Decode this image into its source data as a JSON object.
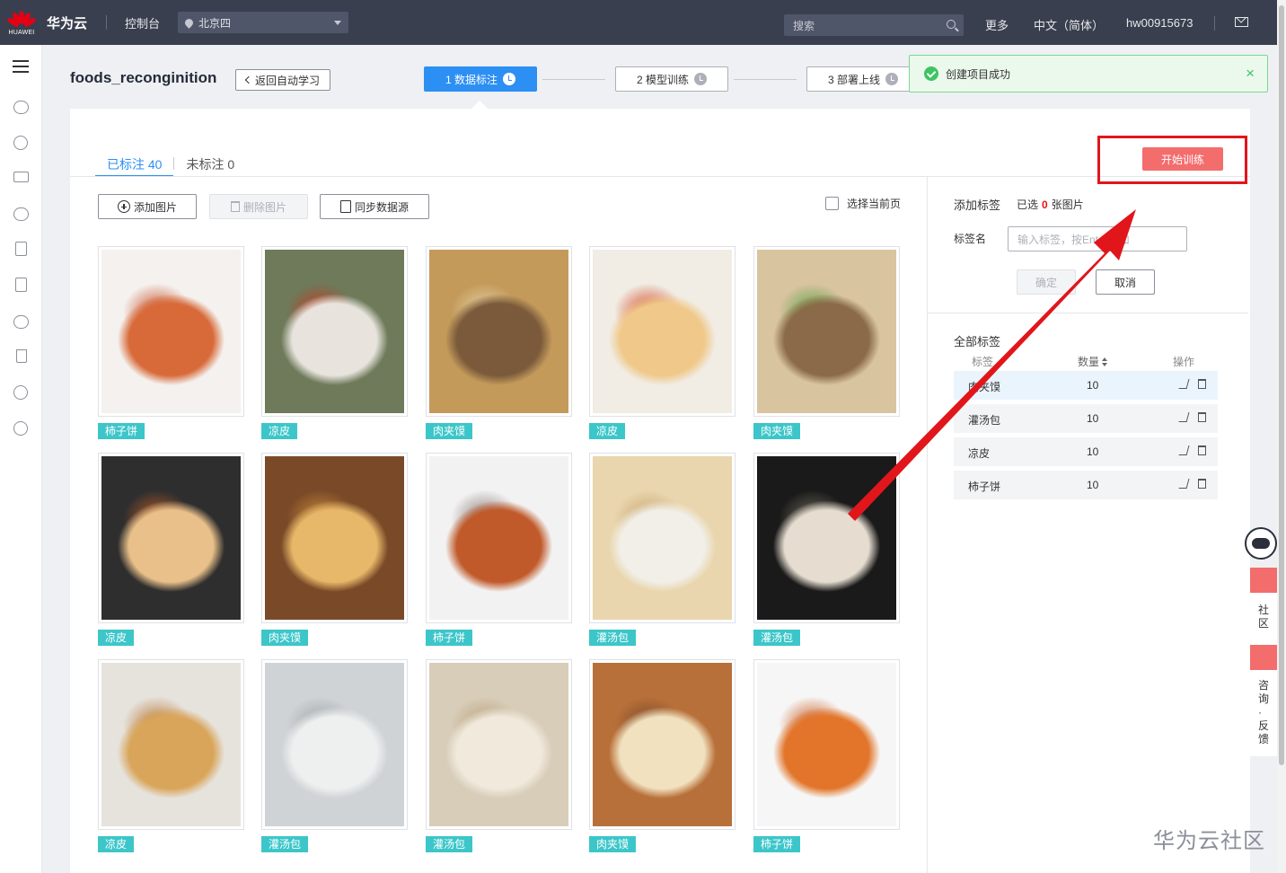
{
  "topbar": {
    "logo_text": "HUAWEI",
    "brand": "华为云",
    "console": "控制台",
    "region": "北京四",
    "search_placeholder": "搜索",
    "more": "更多",
    "language": "中文（简体）",
    "user": "hw00915673"
  },
  "header": {
    "project_name": "foods_recongin",
    "project_name_suffix": "ition",
    "back_label": "返回自动学习",
    "steps": [
      {
        "label": "1 数据标注",
        "state": "active"
      },
      {
        "label": "2 模型训练",
        "state": "pending"
      },
      {
        "label": "3 部署上线",
        "state": "pending"
      }
    ]
  },
  "toast": {
    "message": "创建项目成功",
    "close": "×"
  },
  "tabs": [
    {
      "label": "已标注 40",
      "active": true
    },
    {
      "label": "未标注 0",
      "active": false
    }
  ],
  "start_train_label": "开始训练",
  "toolbar": {
    "add_image": "添加图片",
    "delete_image": "删除图片",
    "sync_source": "同步数据源",
    "select_page": "选择当前页"
  },
  "images": [
    {
      "label": "柿子饼",
      "colors": [
        "#f4f1ee",
        "#d86a3a",
        "#c9522a"
      ]
    },
    {
      "label": "凉皮",
      "colors": [
        "#6e7a5a",
        "#e8e4dd",
        "#c23a22"
      ]
    },
    {
      "label": "肉夹馍",
      "colors": [
        "#c49a5b",
        "#7a5a3a",
        "#e6d3a4"
      ]
    },
    {
      "label": "凉皮",
      "colors": [
        "#f1ece4",
        "#f0c98a",
        "#d24a2a"
      ]
    },
    {
      "label": "肉夹馍",
      "colors": [
        "#d9c4a0",
        "#8a6a48",
        "#5fa048"
      ]
    },
    {
      "label": "凉皮",
      "colors": [
        "#2e2e2e",
        "#e9c08a",
        "#b35a2a"
      ]
    },
    {
      "label": "肉夹馍",
      "colors": [
        "#7a4a28",
        "#e8b86a",
        "#c98a3a"
      ]
    },
    {
      "label": "柿子饼",
      "colors": [
        "#f2f2f2",
        "#c05a2a",
        "#8c7a78"
      ]
    },
    {
      "label": "灌汤包",
      "colors": [
        "#e9d6ae",
        "#f1efe8",
        "#caa472"
      ]
    },
    {
      "label": "灌汤包",
      "colors": [
        "#1a1a1a",
        "#e6ddd0",
        "#6d6a5a"
      ]
    },
    {
      "label": "凉皮",
      "colors": [
        "#e6e2dc",
        "#d9a55a",
        "#b87838"
      ]
    },
    {
      "label": "灌汤包",
      "colors": [
        "#cfd3d6",
        "#eef0f0",
        "#9ea4a8"
      ]
    },
    {
      "label": "灌汤包",
      "colors": [
        "#d8cdb8",
        "#f0e9dc",
        "#b9a17a"
      ]
    },
    {
      "label": "肉夹馍",
      "colors": [
        "#b8703a",
        "#f1e1bf",
        "#7a4a28"
      ]
    },
    {
      "label": "柿子饼",
      "colors": [
        "#f6f6f6",
        "#e2752a",
        "#c9581c"
      ]
    }
  ],
  "right_panel": {
    "add_label_title": "添加标签",
    "selected_prefix": "已选",
    "selected_count": "0",
    "selected_suffix": "张图片",
    "label_name": "标签名",
    "input_placeholder": "输入标签，按Enter添加",
    "confirm": "确定",
    "cancel": "取消",
    "all_labels": "全部标签",
    "col_label": "标签",
    "col_count": "数量",
    "col_ops": "操作",
    "labels": [
      {
        "name": "肉夹馍",
        "count": "10"
      },
      {
        "name": "灌汤包",
        "count": "10"
      },
      {
        "name": "凉皮",
        "count": "10"
      },
      {
        "name": "柿子饼",
        "count": "10"
      }
    ]
  },
  "float": {
    "community": "社区",
    "consult": "咨询·反馈"
  },
  "watermark": "华为云社区",
  "colors": {
    "accent": "#2c8ff4",
    "danger": "#e1161b",
    "tag": "#3cc6c9",
    "start_button": "#f36d6d"
  }
}
